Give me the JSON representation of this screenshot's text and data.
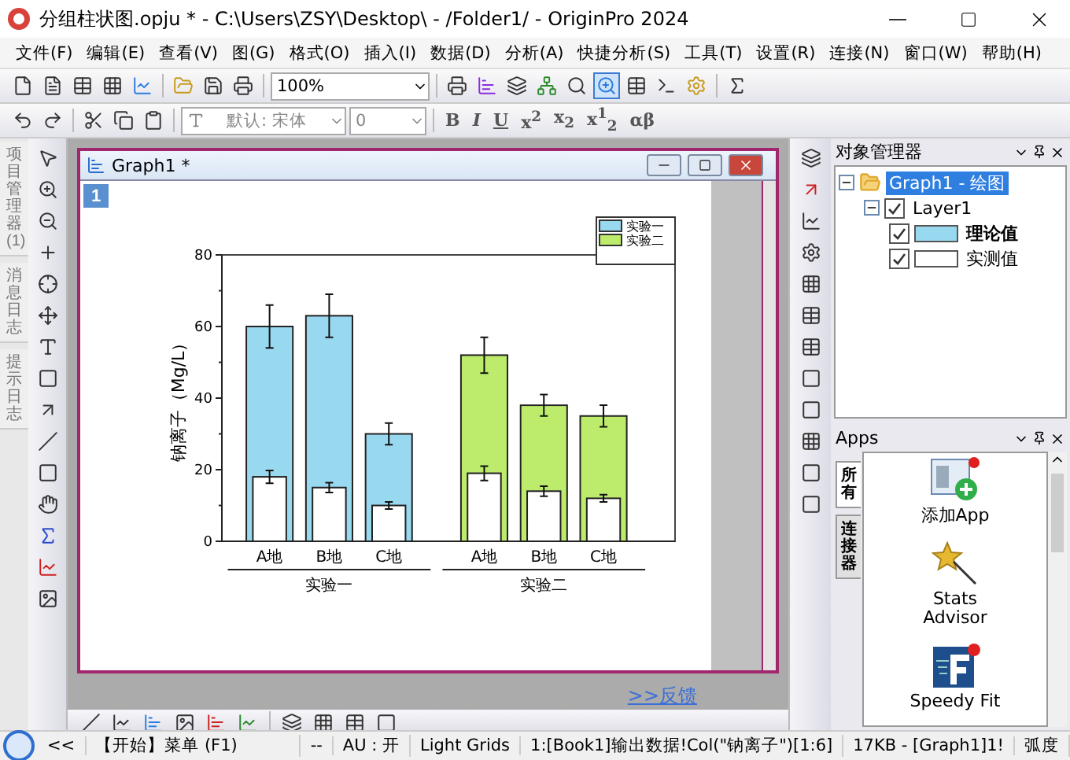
{
  "window": {
    "title": "分组柱状图.opju * - C:\\Users\\ZSY\\Desktop\\ - /Folder1/ - OriginPro 2024"
  },
  "menu": [
    "文件(F)",
    "编辑(E)",
    "查看(V)",
    "图(G)",
    "格式(O)",
    "插入(I)",
    "数据(D)",
    "分析(A)",
    "快捷分析(S)",
    "工具(T)",
    "设置(R)",
    "连接(N)",
    "窗口(W)",
    "帮助(H)"
  ],
  "toolbar": {
    "zoom": "100%",
    "font": "默认: 宋体",
    "font_size": "0",
    "format_buttons": [
      "B",
      "I",
      "U",
      "x$^{2}$",
      "x$_{2}$",
      "x$^{1}$$_{2}$",
      "αβ"
    ]
  },
  "left_tabs": [
    {
      "label": "项目管理器 (1)",
      "selected": false
    },
    {
      "label": "消息日志",
      "selected": false
    },
    {
      "label": "提示日志",
      "selected": false
    }
  ],
  "graph_window": {
    "title": "Graph1 *",
    "page_label": "1",
    "chart": {
      "legend": [
        {
          "label": "实验一",
          "color": "#99d9f0"
        },
        {
          "label": "实验二",
          "color": "#bdec6c"
        }
      ],
      "groups": [
        {
          "label": "实验一"
        },
        {
          "label": "实验二"
        }
      ],
      "chart_data": {
        "type": "bar",
        "ylabel": "钠离子（Mg/L）",
        "categories": [
          "A地",
          "B地",
          "C地",
          "A地",
          "B地",
          "C地"
        ],
        "series": [
          {
            "colors": [
              "#99d9f0",
              "#99d9f0",
              "#99d9f0",
              "#bdec6c",
              "#bdec6c",
              "#bdec6c"
            ],
            "values": [
              60,
              63,
              30,
              52,
              38,
              35
            ],
            "errors": [
              6,
              6,
              3,
              5,
              3,
              3
            ]
          },
          {
            "color": "#ffffff",
            "values": [
              18,
              15,
              10,
              19,
              14,
              12
            ],
            "errors": [
              1.8,
              1.4,
              1,
              2,
              1.4,
              1
            ]
          }
        ],
        "ylim": [
          0,
          80
        ],
        "yticks": [
          0,
          20,
          40,
          60,
          80
        ]
      }
    }
  },
  "feedback_link": ">>反馈",
  "object_manager": {
    "title": "对象管理器",
    "tree": [
      {
        "label": "Graph1 - 绘图",
        "selected": true,
        "expanded": true,
        "children": [
          {
            "label": "Layer1",
            "selected": false,
            "checked": true,
            "expanded": true,
            "children": [
              {
                "label": "理论值",
                "selected": false,
                "checked": true,
                "active": true,
                "color": "#99d9f0"
              },
              {
                "label": "实测值",
                "selected": false,
                "checked": true,
                "active": false,
                "color": "#ffffff"
              }
            ]
          }
        ]
      }
    ]
  },
  "apps": {
    "title": "Apps",
    "tabs": [
      {
        "label": "所有",
        "selected": true
      },
      {
        "label": "连接器",
        "selected": false
      }
    ],
    "items": [
      "添加App",
      "Stats Advisor",
      "Speedy Fit"
    ]
  },
  "status_bar": [
    "<<",
    "【开始】菜单 (F1)",
    "--",
    "AU : 开",
    "Light Grids",
    "1:[Book1]输出数据!Col(\"钠离子\")[1:6]",
    "17KB - [Graph1]1!",
    "弧度"
  ]
}
